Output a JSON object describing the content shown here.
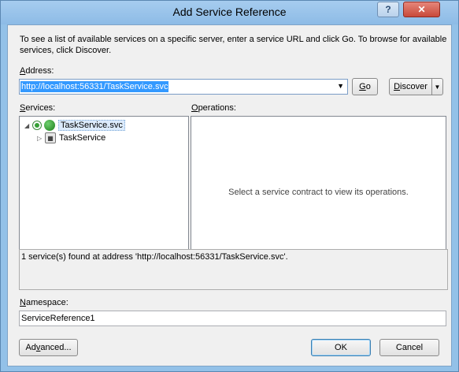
{
  "window": {
    "title": "Add Service Reference",
    "help_glyph": "?",
    "close_glyph": "✕"
  },
  "intro": "To see a list of available services on a specific server, enter a service URL and click Go. To browse for available services, click Discover.",
  "address": {
    "label_prefix": "",
    "label_mnemonic": "A",
    "label_rest": "ddress:",
    "value": "http://localhost:56331/TaskService.svc",
    "dropdown_glyph": "▼"
  },
  "buttons": {
    "go_mnemonic": "G",
    "go_rest": "o",
    "discover_mnemonic": "D",
    "discover_rest": "iscover",
    "discover_arrow": "▼",
    "advanced_prefix": "Ad",
    "advanced_mnemonic": "v",
    "advanced_rest": "anced...",
    "ok": "OK",
    "cancel": "Cancel"
  },
  "services": {
    "label_mnemonic": "S",
    "label_rest": "ervices:",
    "tree": [
      {
        "label": "TaskService.svc",
        "expanded": true,
        "selected": true
      },
      {
        "label": "TaskService",
        "expanded": false,
        "selected": false
      }
    ],
    "expanded_glyph": "◢",
    "collapsed_glyph": "▷"
  },
  "operations": {
    "label_mnemonic": "O",
    "label_rest": "perations:",
    "empty_text": "Select a service contract to view its operations."
  },
  "status": "1 service(s) found at address 'http://localhost:56331/TaskService.svc'.",
  "namespace": {
    "label_mnemonic": "N",
    "label_rest": "amespace:",
    "value": "ServiceReference1"
  },
  "colors": {
    "title_bar": "#93c1e8",
    "selection": "#3399ff",
    "close_button": "#c84a3a"
  }
}
